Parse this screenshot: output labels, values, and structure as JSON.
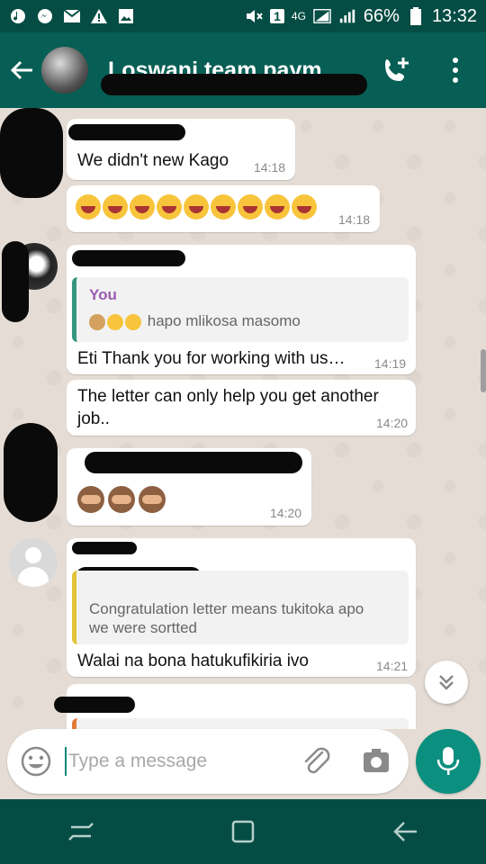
{
  "status_bar": {
    "battery": "66%",
    "time": "13:32",
    "network": "4G",
    "sim_badge": "1"
  },
  "header": {
    "title": "Loswani team paym…"
  },
  "messages": [
    {
      "text": "We didn't new Kago",
      "time": "14:18"
    },
    {
      "emoji": "rolling-on-floor-laughing x9",
      "time": "14:18"
    },
    {
      "quote_author": "You",
      "quote_text": "hapo mlikosa masomo",
      "text": "Eti Thank you for working with us…",
      "time": "14:19"
    },
    {
      "text_line1": "The letter can only help you get another",
      "text_line2": "job..",
      "time": "14:20"
    },
    {
      "emoji": "see-no-evil-monkey x3",
      "time": "14:20"
    },
    {
      "quote_line1": "Congratulation letter means tukitoka apo",
      "quote_line2": "we were sortted",
      "text": "Walai na bona hatukufikiria ivo",
      "time": "14:21"
    }
  ],
  "composer": {
    "placeholder": "Type a message"
  },
  "colors": {
    "header": "#075e54",
    "status_bar": "#054d44",
    "accent": "#0b8f7f",
    "chat_bg": "#e5ddd5",
    "quote_author": "#9c5cb1"
  }
}
